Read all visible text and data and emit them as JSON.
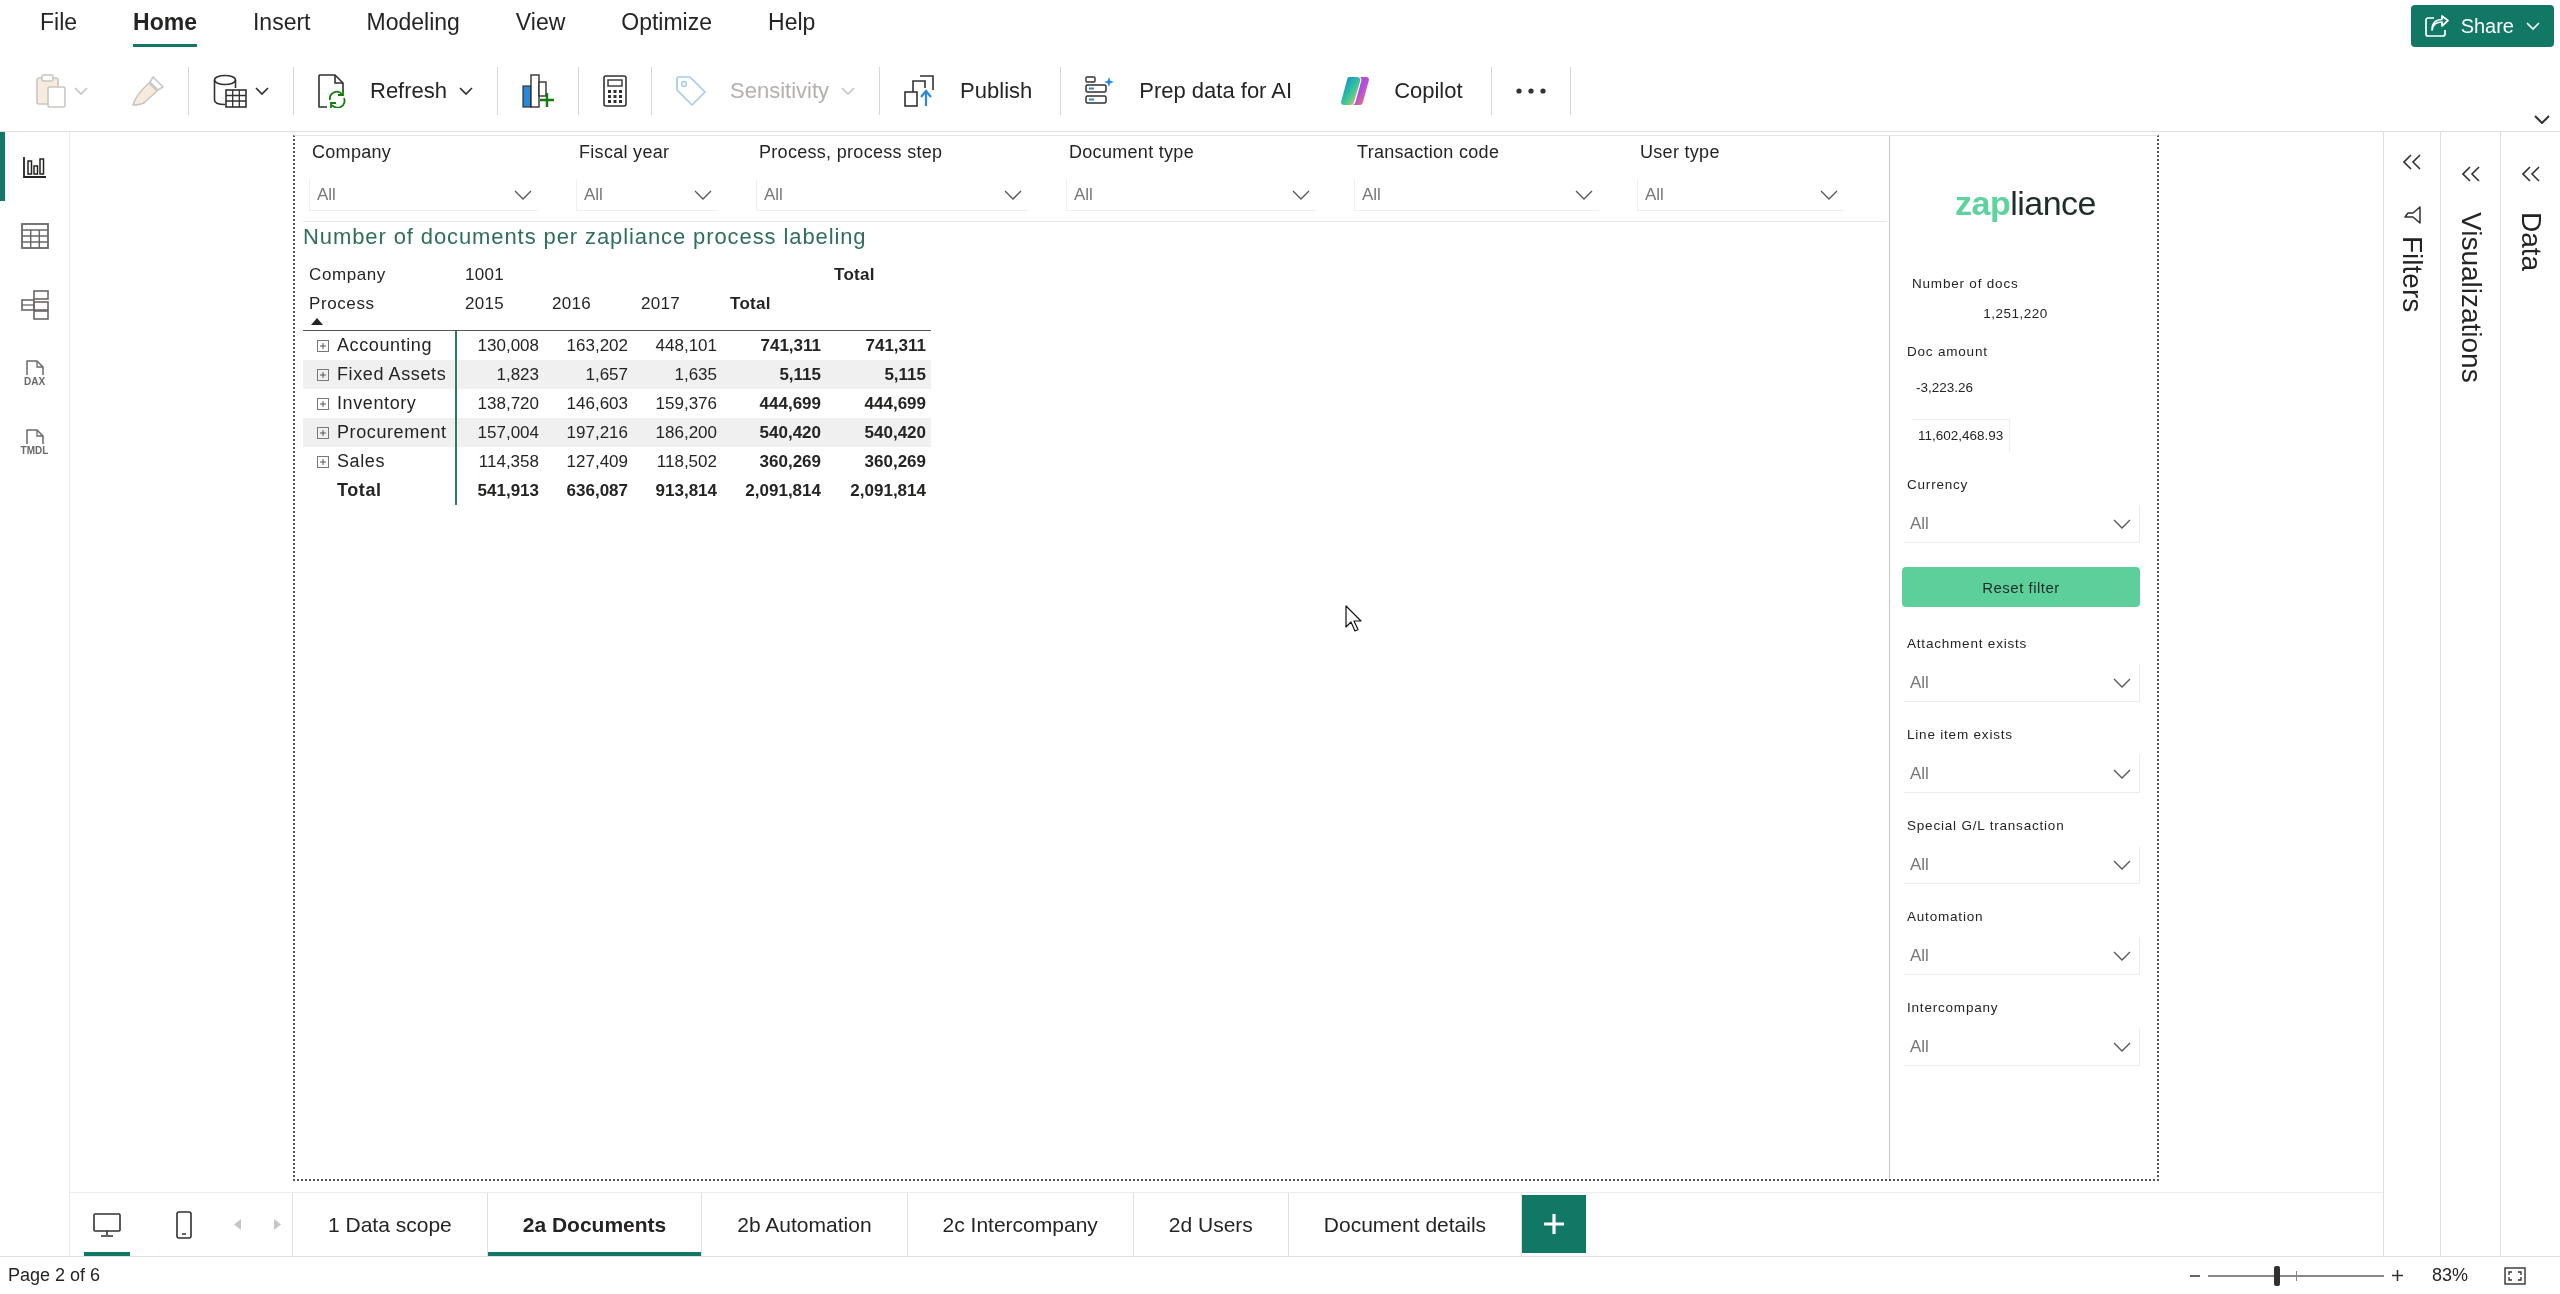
{
  "menu_tabs": [
    {
      "label": "File",
      "selected": false
    },
    {
      "label": "Home",
      "selected": true
    },
    {
      "label": "Insert",
      "selected": false
    },
    {
      "label": "Modeling",
      "selected": false
    },
    {
      "label": "View",
      "selected": false
    },
    {
      "label": "Optimize",
      "selected": false
    },
    {
      "label": "Help",
      "selected": false
    }
  ],
  "share_button": {
    "label": "Share"
  },
  "ribbon_groups": [
    {
      "buttons": [
        {
          "disabled": true,
          "dropdown": true
        },
        {
          "disabled": true,
          "dropdown": false
        }
      ]
    },
    {
      "buttons": [
        {
          "disabled": false,
          "dropdown": true
        }
      ]
    },
    {
      "buttons": [
        {
          "label": "Refresh",
          "disabled": false,
          "dropdown": true
        }
      ]
    },
    {
      "buttons": [
        {
          "disabled": false,
          "dropdown": false
        }
      ]
    },
    {
      "buttons": [
        {
          "disabled": false,
          "dropdown": false
        }
      ]
    },
    {
      "buttons": [
        {
          "label": "Sensitivity",
          "disabled": true,
          "dropdown": true
        }
      ]
    },
    {
      "buttons": [
        {
          "label": "Publish",
          "disabled": false,
          "dropdown": false
        }
      ]
    },
    {
      "buttons": [
        {
          "label": "Prep data for AI",
          "disabled": false,
          "dropdown": false
        },
        {
          "label": "Copilot",
          "disabled": false,
          "dropdown": false
        }
      ]
    },
    {
      "buttons": [
        {
          "disabled": false,
          "dropdown": false
        }
      ]
    }
  ],
  "left_nav": [
    {
      "selected": true
    },
    {
      "selected": false
    },
    {
      "selected": false
    },
    {
      "label": "DAX",
      "selected": false
    },
    {
      "label": "TMDL",
      "selected": false
    }
  ],
  "slicers": [
    {
      "label": "Company",
      "value": "All"
    },
    {
      "label": "Fiscal year",
      "value": "All"
    },
    {
      "label": "Process, process step",
      "value": "All"
    },
    {
      "label": "Document type",
      "value": "All"
    },
    {
      "label": "Transaction code",
      "value": "All"
    },
    {
      "label": "User type",
      "value": "All"
    }
  ],
  "matrix": {
    "title": "Number of documents per zapliance process labeling",
    "column_headers": {
      "row_1_label": "Company",
      "company": "1001",
      "grand_total": "Total",
      "row_2_label": "Process",
      "sorted": true,
      "years": [
        "2015",
        "2016",
        "2017"
      ],
      "subtotal": "Total"
    },
    "rows": [
      {
        "label": "Accounting",
        "expanded": false,
        "values": [
          "130,008",
          "163,202",
          "448,101",
          "741,311",
          "741,311"
        ]
      },
      {
        "label": "Fixed Assets",
        "expanded": false,
        "values": [
          "1,823",
          "1,657",
          "1,635",
          "5,115",
          "5,115"
        ]
      },
      {
        "label": "Inventory",
        "expanded": false,
        "values": [
          "138,720",
          "146,603",
          "159,376",
          "444,699",
          "444,699"
        ]
      },
      {
        "label": "Procurement",
        "expanded": false,
        "values": [
          "157,004",
          "197,216",
          "186,200",
          "540,420",
          "540,420"
        ]
      },
      {
        "label": "Sales",
        "expanded": false,
        "values": [
          "114,358",
          "127,409",
          "118,502",
          "360,269",
          "360,269"
        ]
      }
    ],
    "total_row": {
      "label": "Total",
      "values": [
        "541,913",
        "636,087",
        "913,814",
        "2,091,814",
        "2,091,814"
      ]
    }
  },
  "side_panel": {
    "logo": {
      "accent": "zap",
      "rest": "liance"
    },
    "items": [
      {
        "kind": "kpi",
        "label": "Number of docs",
        "value": "1,251,220"
      },
      {
        "kind": "range",
        "label": "Doc amount",
        "min": "-3,223.26",
        "max": "11,602,468.93"
      },
      {
        "kind": "dropdown",
        "label": "Currency",
        "value": "All"
      },
      {
        "kind": "button",
        "label": "Reset filter"
      },
      {
        "kind": "dropdown",
        "label": "Attachment exists",
        "value": "All"
      },
      {
        "kind": "dropdown",
        "label": "Line item exists",
        "value": "All"
      },
      {
        "kind": "dropdown",
        "label": "Special G/L transaction",
        "value": "All"
      },
      {
        "kind": "dropdown",
        "label": "Automation",
        "value": "All"
      },
      {
        "kind": "dropdown",
        "label": "Intercompany",
        "value": "All"
      }
    ]
  },
  "panes": [
    {
      "kind": "filters",
      "label": "Filters"
    },
    {
      "kind": "pane",
      "label": "Visualizations"
    },
    {
      "kind": "pane",
      "label": "Data"
    }
  ],
  "view_modes": [
    {
      "selected": true
    },
    {
      "selected": false
    }
  ],
  "page_arrows": [
    {
      "disabled": true
    },
    {
      "disabled": true
    }
  ],
  "page_tabs": [
    {
      "label": "1 Data scope",
      "selected": false
    },
    {
      "label": "2a Documents",
      "selected": true
    },
    {
      "label": "2b Automation",
      "selected": false
    },
    {
      "label": "2c Intercompany",
      "selected": false
    },
    {
      "label": "2d Users",
      "selected": false
    },
    {
      "label": "Document details",
      "selected": false
    }
  ],
  "status_bar": {
    "page": "Page 2 of 6",
    "zoom": {
      "level": 0.39,
      "reading": "83%"
    }
  }
}
